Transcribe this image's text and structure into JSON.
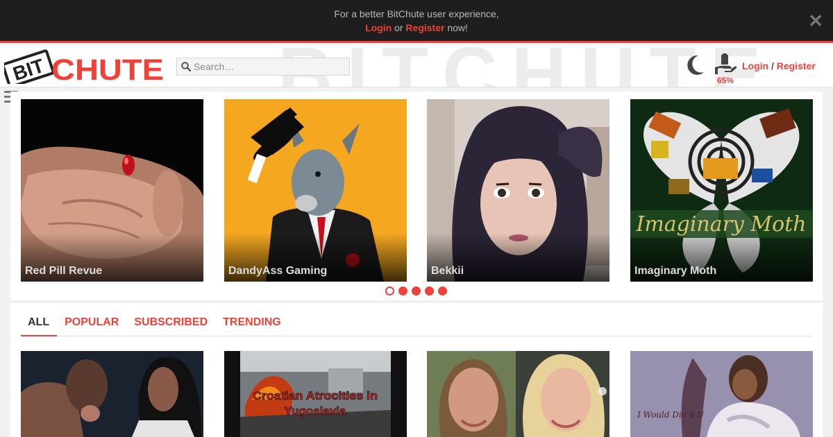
{
  "notice": {
    "message": "For a better BitChute user experience,",
    "login_label": "Login",
    "or_text": "or",
    "register_label": "Register",
    "suffix": "now!",
    "close_glyph": "✕"
  },
  "header": {
    "logo_text_left": "BIT",
    "logo_text_right": "CHUTE",
    "search_placeholder": "Search…",
    "donate_percent": "65%",
    "login_label": "Login",
    "separator": "/",
    "register_label": "Register"
  },
  "carousel": {
    "cards": [
      {
        "name": "Red Pill Revue"
      },
      {
        "name": "DandyAss Gaming"
      },
      {
        "name": "Bekkii"
      },
      {
        "name": "Imaginary Moth",
        "overlay_text": "Imaginary Moth"
      }
    ],
    "dots": 5,
    "active_dot": 0
  },
  "tabs": [
    {
      "label": "ALL",
      "active": true
    },
    {
      "label": "POPULAR"
    },
    {
      "label": "SUBSCRIBED"
    },
    {
      "label": "TRENDING"
    }
  ],
  "videos": [
    {
      "overlay_text": ""
    },
    {
      "overlay_text": "Croatian Atrocities in Yugoslavia",
      "line1": "Croatian Atrocities in",
      "line2": "Yugoslavia"
    },
    {
      "overlay_text": ""
    },
    {
      "overlay_text": "I Would Die 4 U"
    }
  ],
  "colors": {
    "accent": "#ef4137",
    "notice_bg": "#1e1e1e",
    "page_bg": "#f1f1f1"
  }
}
